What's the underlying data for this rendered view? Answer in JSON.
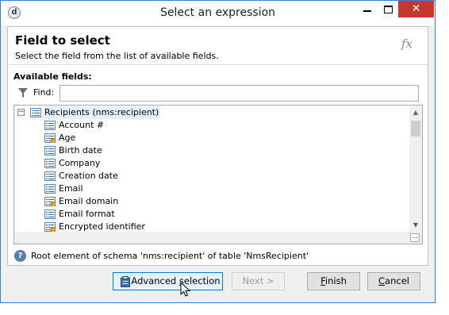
{
  "window": {
    "title": "Select an expression",
    "close_glyph": "✕",
    "app_icon_glyph": "d"
  },
  "header": {
    "title": "Field to select",
    "subtitle": "Select the field from the list of available fields.",
    "fx_label": "fx"
  },
  "fields": {
    "label": "Available fields:",
    "find_label": "Find:",
    "find_value": "",
    "root": "Recipients (nms:recipient)",
    "root_expander": "−",
    "items": [
      {
        "label": "Account #",
        "icon": "list-icon"
      },
      {
        "label": "Age",
        "icon": "calculated-field-icon"
      },
      {
        "label": "Birth date",
        "icon": "list-icon"
      },
      {
        "label": "Company",
        "icon": "list-icon"
      },
      {
        "label": "Creation date",
        "icon": "list-icon"
      },
      {
        "label": "Email",
        "icon": "list-icon"
      },
      {
        "label": "Email domain",
        "icon": "calculated-field-icon"
      },
      {
        "label": "Email format",
        "icon": "list-icon"
      },
      {
        "label": "Encrypted identifier",
        "icon": "calculated-field-icon"
      }
    ],
    "corner_glyph": "..."
  },
  "help": {
    "text": "Root element of schema 'nms:recipient' of table 'NmsRecipient'",
    "glyph": "?"
  },
  "buttons": {
    "advanced_pre": "Advanced ",
    "advanced_u": "s",
    "advanced_post": "election",
    "next": "Next >",
    "finish_u": "F",
    "finish_post": "inish",
    "cancel_u": "C",
    "cancel_post": "ancel"
  },
  "colors": {
    "accent": "#0078d7",
    "close": "#c7372f",
    "selection": "#e5f0fb"
  }
}
